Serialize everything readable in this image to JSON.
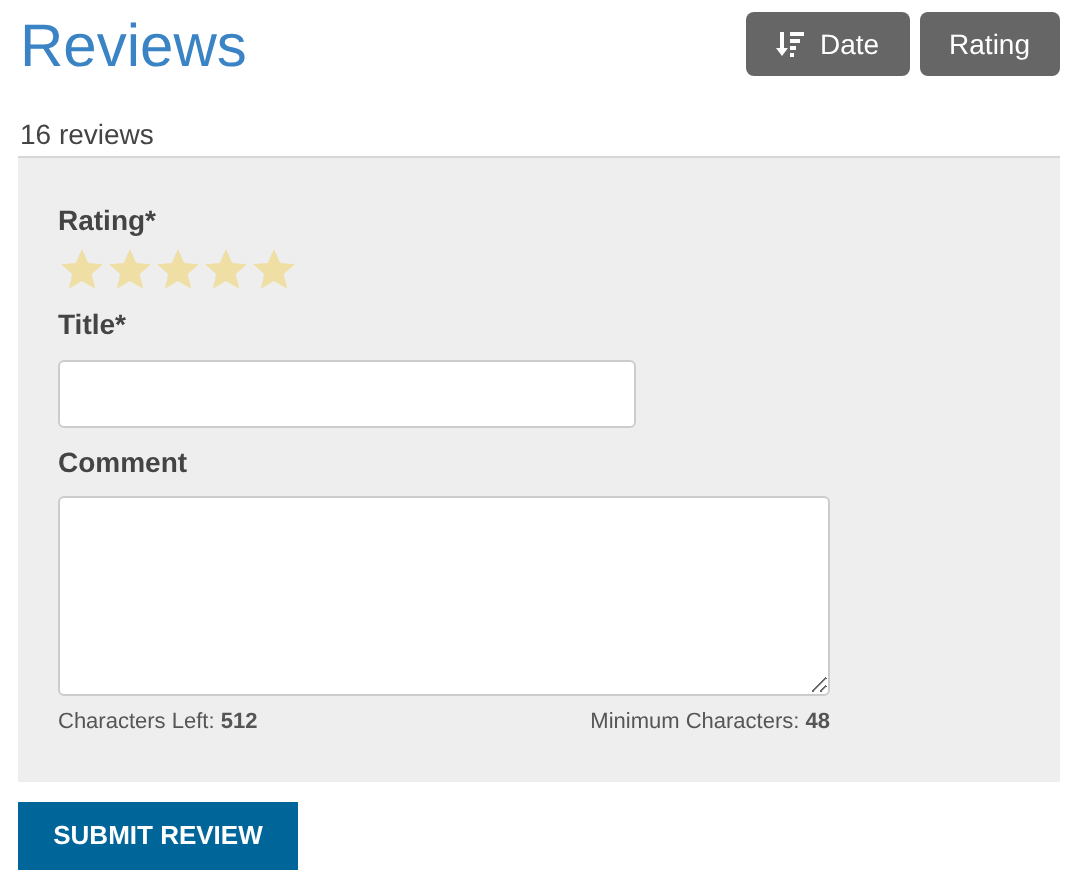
{
  "header": {
    "title": "Reviews",
    "sort_buttons": [
      {
        "label": "Date",
        "kind": "sorted"
      },
      {
        "label": "Rating",
        "kind": "plain"
      }
    ]
  },
  "count": "16 reviews",
  "form": {
    "rating": {
      "label": "Rating*",
      "stars": 5
    },
    "title_field": {
      "label": "Title*"
    },
    "comment_field": {
      "label": "Comment"
    },
    "characters_left": {
      "label": "Characters Left:",
      "value": "512"
    },
    "minimum_characters": {
      "label": "Minimum Characters:",
      "value": "48"
    }
  },
  "submit_button": "SUBMIT REVIEW"
}
